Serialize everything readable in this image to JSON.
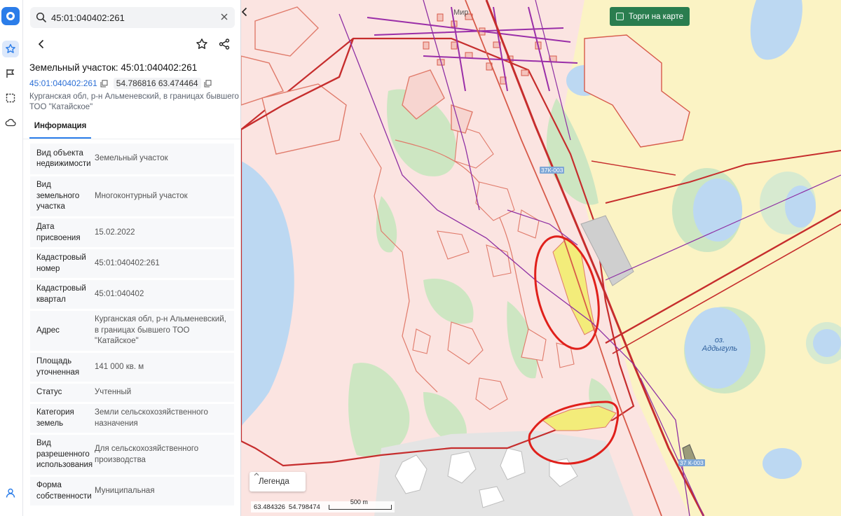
{
  "search": {
    "value": "45:01:040402:261"
  },
  "object": {
    "title": "Земельный участок: 45:01:040402:261",
    "cadastral_link": "45:01:040402:261",
    "coordinates": "54.786816 63.474464",
    "address": "Курганская обл, р-н Альменевский, в границах бывшего ТОО \"Катайское\""
  },
  "tabs": {
    "info": "Информация"
  },
  "info_rows": [
    {
      "key": "Вид объекта недвижимости",
      "value": "Земельный участок"
    },
    {
      "key": "Вид земельного участка",
      "value": "Многоконтурный участок"
    },
    {
      "key": "Дата присвоения",
      "value": "15.02.2022"
    },
    {
      "key": "Кадастровый номер",
      "value": "45:01:040402:261"
    },
    {
      "key": "Кадастровый квартал",
      "value": "45:01:040402"
    },
    {
      "key": "Адрес",
      "value": "Курганская обл, р-н Альменевский, в границах бывшего ТОО \"Катайское\""
    },
    {
      "key": "Площадь уточненная",
      "value": "141 000 кв. м"
    },
    {
      "key": "Статус",
      "value": "Учтенный"
    },
    {
      "key": "Категория земель",
      "value": "Земли сельскохозяйственного назначения"
    },
    {
      "key": "Вид разрешенного использования",
      "value": "Для сельскохозяйственного производства"
    },
    {
      "key": "Форма собственности",
      "value": "Муниципальная"
    }
  ],
  "map": {
    "torgi_label": "Торги на карте",
    "legend_label": "Легенда",
    "scale_coords_lon": "63.484326",
    "scale_coords_lat": "54.798474",
    "scale_label": "500 m",
    "lake_label": "оз.\nАддыгуль",
    "town_label": "Мир",
    "road_label_1": "37К-003",
    "road_label_2": "37 К-003"
  },
  "colors": {
    "accent": "#2b7de9",
    "parcel_fill": "#fbe4e1",
    "parcel_stroke": "#e07a6a",
    "forest": "#cde6c2",
    "field": "#fbf3c4",
    "water": "#bcd8f2",
    "torgi_btn": "#2a7d4f",
    "highlight": "#f3ec7a",
    "boundary": "#c62d2d",
    "admin_line": "#8e2fa3"
  }
}
